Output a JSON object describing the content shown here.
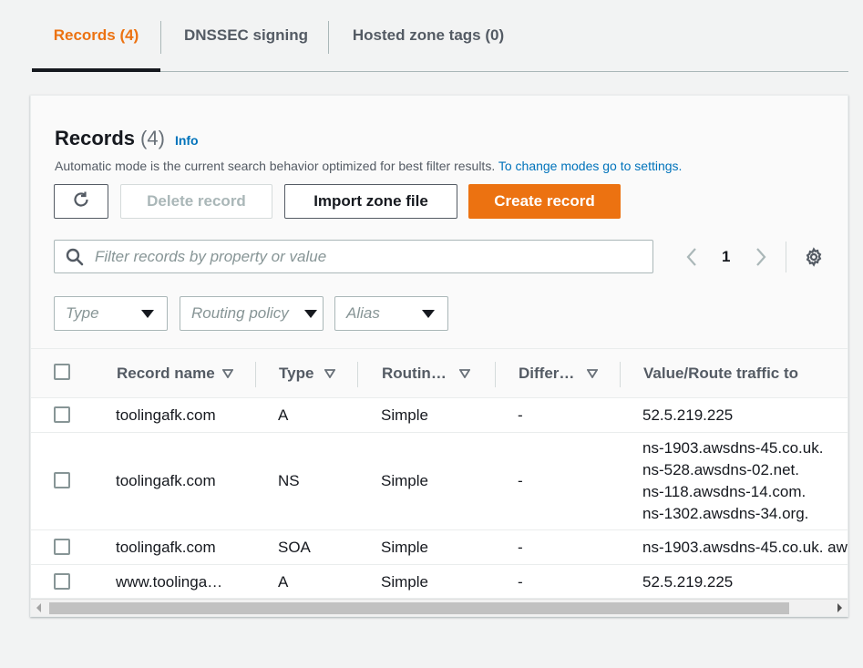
{
  "tabs": [
    {
      "label": "Records (4)",
      "active": true
    },
    {
      "label": "DNSSEC signing",
      "active": false
    },
    {
      "label": "Hosted zone tags (0)",
      "active": false
    }
  ],
  "panel": {
    "title": "Records",
    "count": "(4)",
    "info_link": "Info",
    "description": "Automatic mode is the current search behavior optimized for best filter results. ",
    "description_link": "To change modes go to settings."
  },
  "actions": {
    "refresh_icon": "refresh-icon",
    "delete_label": "Delete record",
    "import_label": "Import zone file",
    "create_label": "Create record"
  },
  "search": {
    "placeholder": "Filter records by property or value",
    "icon": "search-icon"
  },
  "pagination": {
    "current_page": "1",
    "prev_icon": "chevron-left-icon",
    "next_icon": "chevron-right-icon",
    "settings_icon": "gear-icon"
  },
  "filters": [
    {
      "placeholder": "Type"
    },
    {
      "placeholder": "Routing policy"
    },
    {
      "placeholder": "Alias"
    }
  ],
  "table": {
    "columns": [
      "Record name",
      "Type",
      "Routin…",
      "Differ…",
      "Value/Route traffic to"
    ],
    "rows": [
      {
        "name": "toolingafk.com",
        "type": "A",
        "routing": "Simple",
        "differ": "-",
        "value": [
          "52.5.219.225"
        ]
      },
      {
        "name": "toolingafk.com",
        "type": "NS",
        "routing": "Simple",
        "differ": "-",
        "value": [
          "ns-1903.awsdns-45.co.uk.",
          "ns-528.awsdns-02.net.",
          "ns-118.awsdns-14.com.",
          "ns-1302.awsdns-34.org."
        ]
      },
      {
        "name": "toolingafk.com",
        "type": "SOA",
        "routing": "Simple",
        "differ": "-",
        "value": [
          "ns-1903.awsdns-45.co.uk. aw"
        ]
      },
      {
        "name": "www.toolinga…",
        "type": "A",
        "routing": "Simple",
        "differ": "-",
        "value": [
          "52.5.219.225"
        ]
      }
    ]
  },
  "colors": {
    "accent": "#ec7211",
    "link": "#0073bb",
    "text": "#16191f"
  }
}
